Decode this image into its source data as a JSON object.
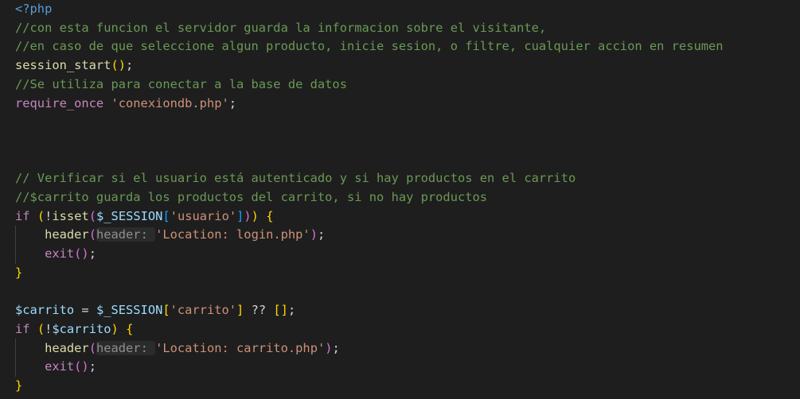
{
  "editor": {
    "colors": {
      "background": "#1e1e1e",
      "comment": "#6a9955",
      "function": "#dcdcaa",
      "string": "#ce9178",
      "variable": "#9cdcfe",
      "control": "#c586c0",
      "keyword": "#569cd6"
    },
    "lines": [
      [
        {
          "t": "<?php",
          "c": "tag"
        }
      ],
      [
        {
          "t": "//con esta funcion el servidor guarda la informacion sobre el visitante,",
          "c": "comment"
        }
      ],
      [
        {
          "t": "//en caso de que seleccione algun producto, inicie sesion, o filtre, cualquier accion en resumen",
          "c": "comment"
        }
      ],
      [
        {
          "t": "session_start",
          "c": "fn"
        },
        {
          "t": "()",
          "c": "paren"
        },
        {
          "t": ";",
          "c": "plain"
        }
      ],
      [
        {
          "t": "//Se utiliza para conectar a la base de datos",
          "c": "comment"
        }
      ],
      [
        {
          "t": "require_once",
          "c": "ctrl"
        },
        {
          "t": " ",
          "c": "plain"
        },
        {
          "t": "'conexiondb.php'",
          "c": "str"
        },
        {
          "t": ";",
          "c": "plain"
        }
      ],
      [],
      [],
      [],
      [
        {
          "t": "// Verificar si el usuario está autenticado y si hay productos en el carrito",
          "c": "comment"
        }
      ],
      [
        {
          "t": "//$carrito guarda los productos del carrito, si no hay productos",
          "c": "comment"
        }
      ],
      [
        {
          "t": "if",
          "c": "ctrl"
        },
        {
          "t": " ",
          "c": "plain"
        },
        {
          "t": "(",
          "c": "paren"
        },
        {
          "t": "!",
          "c": "plain"
        },
        {
          "t": "isset",
          "c": "fn"
        },
        {
          "t": "(",
          "c": "bracket2"
        },
        {
          "t": "$_SESSION",
          "c": "var"
        },
        {
          "t": "[",
          "c": "bracket3"
        },
        {
          "t": "'usuario'",
          "c": "str"
        },
        {
          "t": "]",
          "c": "bracket3"
        },
        {
          "t": ")",
          "c": "bracket2"
        },
        {
          "t": ")",
          "c": "paren"
        },
        {
          "t": " ",
          "c": "plain"
        },
        {
          "t": "{",
          "c": "paren"
        }
      ],
      [
        {
          "t": "    ",
          "c": "plain"
        },
        {
          "t": "header",
          "c": "fn"
        },
        {
          "t": "(",
          "c": "bracket2"
        },
        {
          "t": "header: ",
          "c": "hint"
        },
        {
          "t": "'Location: login.php'",
          "c": "str"
        },
        {
          "t": ")",
          "c": "bracket2"
        },
        {
          "t": ";",
          "c": "plain"
        }
      ],
      [
        {
          "t": "    ",
          "c": "plain"
        },
        {
          "t": "exit",
          "c": "ctrl"
        },
        {
          "t": "()",
          "c": "bracket2"
        },
        {
          "t": ";",
          "c": "plain"
        }
      ],
      [
        {
          "t": "}",
          "c": "paren"
        }
      ],
      [],
      [
        {
          "t": "$carrito",
          "c": "var"
        },
        {
          "t": " = ",
          "c": "plain"
        },
        {
          "t": "$_SESSION",
          "c": "var"
        },
        {
          "t": "[",
          "c": "paren"
        },
        {
          "t": "'carrito'",
          "c": "str"
        },
        {
          "t": "]",
          "c": "paren"
        },
        {
          "t": " ?? ",
          "c": "plain"
        },
        {
          "t": "[]",
          "c": "paren"
        },
        {
          "t": ";",
          "c": "plain"
        }
      ],
      [
        {
          "t": "if",
          "c": "ctrl"
        },
        {
          "t": " ",
          "c": "plain"
        },
        {
          "t": "(",
          "c": "paren"
        },
        {
          "t": "!",
          "c": "plain"
        },
        {
          "t": "$carrito",
          "c": "var"
        },
        {
          "t": ")",
          "c": "paren"
        },
        {
          "t": " ",
          "c": "plain"
        },
        {
          "t": "{",
          "c": "paren"
        }
      ],
      [
        {
          "t": "    ",
          "c": "plain"
        },
        {
          "t": "header",
          "c": "fn"
        },
        {
          "t": "(",
          "c": "bracket2"
        },
        {
          "t": "header: ",
          "c": "hint"
        },
        {
          "t": "'Location: carrito.php'",
          "c": "str"
        },
        {
          "t": ")",
          "c": "bracket2"
        },
        {
          "t": ";",
          "c": "plain"
        }
      ],
      [
        {
          "t": "    ",
          "c": "plain"
        },
        {
          "t": "exit",
          "c": "ctrl"
        },
        {
          "t": "()",
          "c": "bracket2"
        },
        {
          "t": ";",
          "c": "plain"
        }
      ],
      [
        {
          "t": "}",
          "c": "paren"
        }
      ]
    ]
  }
}
